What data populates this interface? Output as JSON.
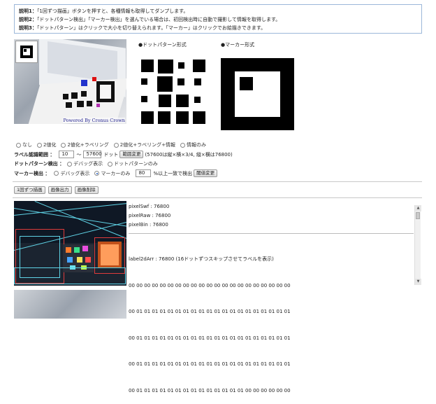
{
  "description": {
    "line1_label": "説明1：",
    "line1_text": "「1回ずつ描画」ボタンを押すと、各種情報も取得してダンプします。",
    "line2_label": "説明2：",
    "line2_text": "「ドットパターン検出」「マーカー検出」を選んでいる場合は、初回検出時に自動で撮影して情報を取得します。",
    "line3_label": "説明3：",
    "line3_text": "「ドットパターン」はクリックで大小を切り替えられます。「マーカー」はクリックでお絵描きできます。"
  },
  "camera": {
    "powered_prefix": "Powered By",
    "powered_brand": "Cronus Crown"
  },
  "patterns": {
    "dot_label": "●ドットパターン形式",
    "marker_label": "●マーカー形式"
  },
  "binarize": {
    "options": [
      "なし",
      "2値化",
      "2値化+ラベリング",
      "2値化+ラベリング+情報",
      "情報のみ"
    ],
    "selected": ""
  },
  "label_range": {
    "label": "ラベル認識範囲 ：",
    "min": "10",
    "tilde": "〜",
    "max": "57600",
    "unit": "ドット",
    "button": "範囲変更",
    "note": "(57600は縦×横×3/4, 縦×横は76800)"
  },
  "dot_detect": {
    "label": "ドットパターン検出 ：",
    "options": [
      "デバッグ表示",
      "ドットパターンのみ"
    ],
    "selected": ""
  },
  "marker_detect": {
    "label": "マーカー検出 ：",
    "options": [
      "デバッグ表示",
      "マーカーのみ"
    ],
    "selected": "マーカーのみ",
    "threshold": "80",
    "threshold_suffix": "%以上一致で検出",
    "button": "閾値変更"
  },
  "actions": {
    "draw_once": "1回ずつ描画",
    "export": "画像出力",
    "delete": "画像削除"
  },
  "results": {
    "pixel_swf": "pixelSwf : 76800",
    "pixel_raw": "pixelRaw : 76800",
    "pixel_bin": "pixelBin : 76800",
    "label_header": "label2dArr : 76800 (16ドットずつスキップさせてラベルを表示)",
    "rows": [
      "00 00 00 00 00 00 00 00 00 00 00 00 00 00 00 00 00 00 00 00 00",
      "00 01 01 01 01 01 01 01 01 01 01 01 01 01 01 01 01 01 01 01 01",
      "00 01 01 01 01 01 01 01 01 01 01 01 01 01 01 01 01 01 01 01 01",
      "00 01 01 01 01 01 01 01 01 01 01 01 01 01 01 01 01 01 01 01 01",
      "00 01 01 01 01 01 01 01 01 01 01 01 01 01 01 00 00 00 00 00 00"
    ]
  },
  "scroll": {
    "up": "▲",
    "down": "▼"
  },
  "colors": {
    "border_blue": "#9bb7d9",
    "radio_selected": "#1a58c5",
    "brand": "#1a1a8a",
    "debug_cyan": "#5fd3e6",
    "debug_red": "#e03b3b"
  }
}
